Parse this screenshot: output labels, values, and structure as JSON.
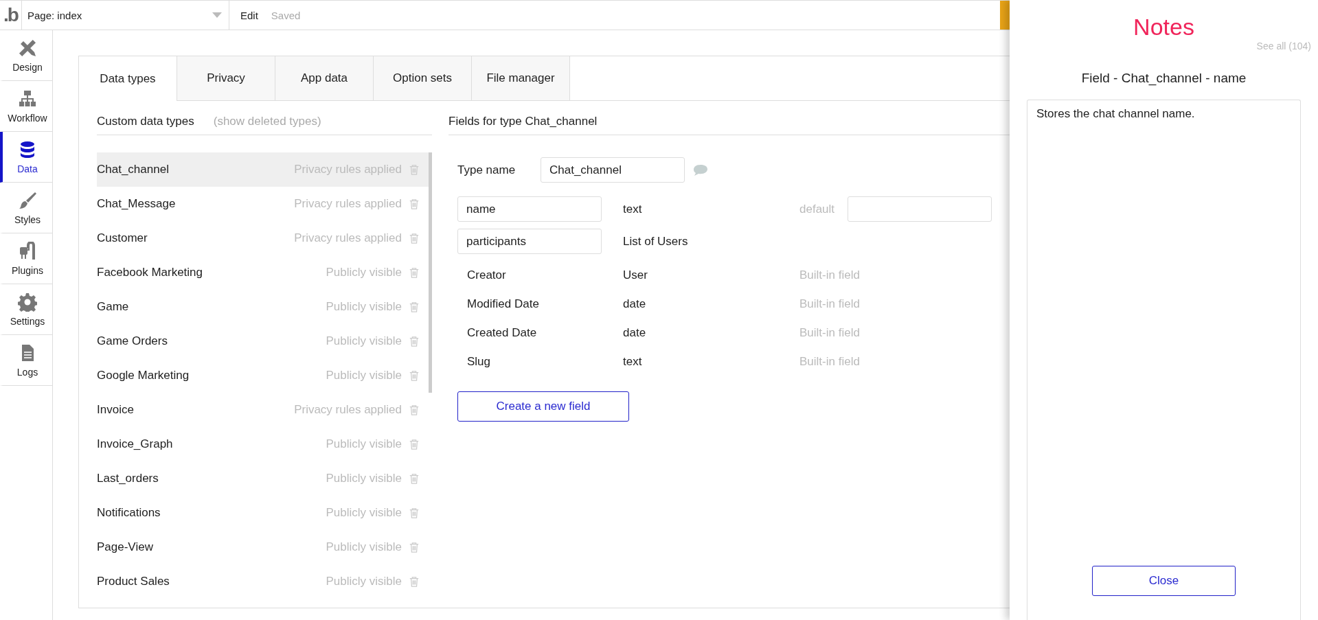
{
  "top_bar": {
    "logo": ".b",
    "page_selector": "Page: index",
    "menu": "Edit",
    "status": "Saved"
  },
  "sidebar": {
    "items": [
      {
        "label": "Design",
        "selected": false
      },
      {
        "label": "Workflow",
        "selected": false
      },
      {
        "label": "Data",
        "selected": true
      },
      {
        "label": "Styles",
        "selected": false
      },
      {
        "label": "Plugins",
        "selected": false
      },
      {
        "label": "Settings",
        "selected": false
      },
      {
        "label": "Logs",
        "selected": false
      }
    ]
  },
  "tabs": [
    {
      "label": "Data types",
      "selected": true
    },
    {
      "label": "Privacy",
      "selected": false
    },
    {
      "label": "App data",
      "selected": false
    },
    {
      "label": "Option sets",
      "selected": false
    },
    {
      "label": "File manager",
      "selected": false
    }
  ],
  "data_types": {
    "title": "Custom data types",
    "link": "(show deleted types)",
    "items": [
      {
        "name": "Chat_channel",
        "privacy": "Privacy rules applied",
        "selected": true
      },
      {
        "name": "Chat_Message",
        "privacy": "Privacy rules applied",
        "selected": false
      },
      {
        "name": "Customer",
        "privacy": "Privacy rules applied",
        "selected": false
      },
      {
        "name": "Facebook Marketing",
        "privacy": "Publicly visible",
        "selected": false
      },
      {
        "name": "Game",
        "privacy": "Publicly visible",
        "selected": false
      },
      {
        "name": "Game Orders",
        "privacy": "Publicly visible",
        "selected": false
      },
      {
        "name": "Google Marketing",
        "privacy": "Publicly visible",
        "selected": false
      },
      {
        "name": "Invoice",
        "privacy": "Privacy rules applied",
        "selected": false
      },
      {
        "name": "Invoice_Graph",
        "privacy": "Publicly visible",
        "selected": false
      },
      {
        "name": "Last_orders",
        "privacy": "Publicly visible",
        "selected": false
      },
      {
        "name": "Notifications",
        "privacy": "Publicly visible",
        "selected": false
      },
      {
        "name": "Page-View",
        "privacy": "Publicly visible",
        "selected": false
      },
      {
        "name": "Product Sales",
        "privacy": "Publicly visible",
        "selected": false
      }
    ]
  },
  "fields": {
    "title": "Fields for type Chat_channel",
    "type_name_label": "Type name",
    "type_name_value": "Chat_channel",
    "custom_fields": [
      {
        "name": "name",
        "type": "text",
        "default_label": "default"
      },
      {
        "name": "participants",
        "type": "List of Users"
      }
    ],
    "built_in": [
      {
        "name": "Creator",
        "type": "User",
        "note": "Built-in field"
      },
      {
        "name": "Modified Date",
        "type": "date",
        "note": "Built-in field"
      },
      {
        "name": "Created Date",
        "type": "date",
        "note": "Built-in field"
      },
      {
        "name": "Slug",
        "type": "text",
        "note": "Built-in field"
      }
    ],
    "create_button": "Create a new field"
  },
  "notes": {
    "title": "Notes",
    "see_all": "See all (104)",
    "subtitle": "Field - Chat_channel - name",
    "text": "Stores the chat channel name.",
    "close_button": "Close"
  }
}
